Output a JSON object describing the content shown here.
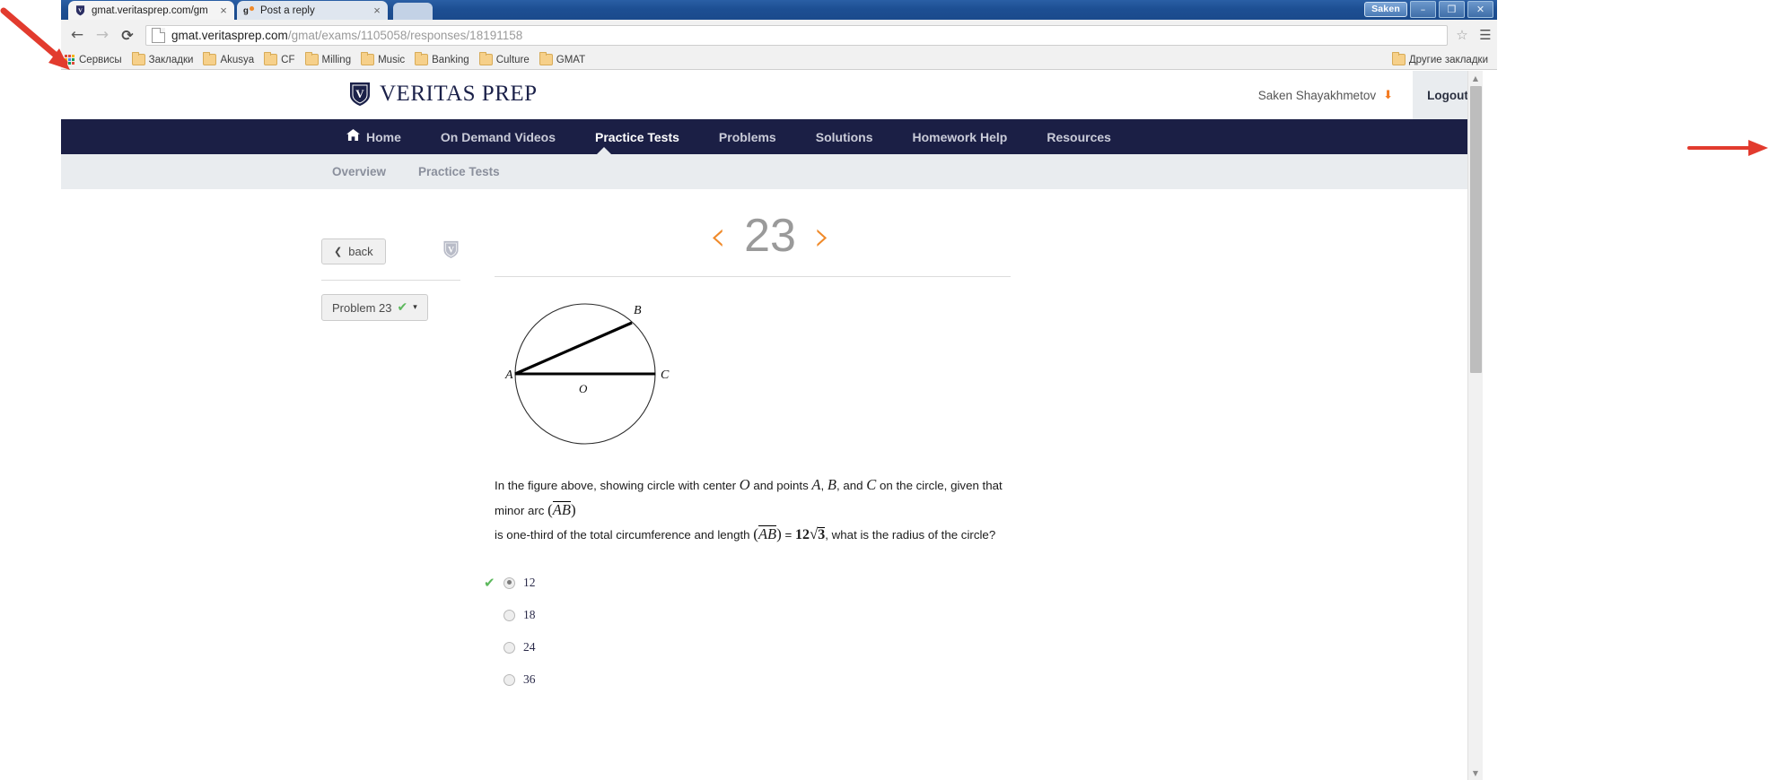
{
  "browser": {
    "tabs": [
      {
        "title": "gmat.veritasprep.com/gm",
        "favicon": "veritas-v-icon",
        "close": "×"
      },
      {
        "title": "Post a reply",
        "favicon": "gmatclub-icon",
        "close": "×"
      }
    ],
    "window_user_chip": "Saken",
    "window_buttons": {
      "minimize": "–",
      "restore": "❐",
      "close": "✕"
    },
    "nav": {
      "back": "←",
      "forward": "→",
      "reload": "⟳"
    },
    "url": {
      "domain": "gmat.veritasprep.com",
      "path": "/gmat/exams/1105058/responses/18191158"
    },
    "star_icon": "☆",
    "menu_icon": "☰",
    "bookmarks": [
      {
        "label": "Сервисы",
        "icon": "apps-grid-icon"
      },
      {
        "label": "Закладки",
        "icon": "folder-icon"
      },
      {
        "label": "Akusya",
        "icon": "folder-icon"
      },
      {
        "label": "CF",
        "icon": "folder-icon"
      },
      {
        "label": "Milling",
        "icon": "folder-icon"
      },
      {
        "label": "Music",
        "icon": "folder-icon"
      },
      {
        "label": "Banking",
        "icon": "folder-icon"
      },
      {
        "label": "Culture",
        "icon": "folder-icon"
      },
      {
        "label": "GMAT",
        "icon": "folder-icon"
      }
    ],
    "other_bookmarks": "Другие закладки"
  },
  "site": {
    "brand": "VERITAS PREP",
    "user_name": "Saken Shayakhmetov",
    "user_caret": "⬇",
    "logout_label": "Logout",
    "main_nav": [
      {
        "label": "Home",
        "icon": "home-icon",
        "active": false
      },
      {
        "label": "On Demand Videos",
        "active": false
      },
      {
        "label": "Practice Tests",
        "active": true
      },
      {
        "label": "Problems",
        "active": false
      },
      {
        "label": "Solutions",
        "active": false
      },
      {
        "label": "Homework Help",
        "active": false
      },
      {
        "label": "Resources",
        "active": false
      }
    ],
    "sub_nav": [
      {
        "label": "Overview"
      },
      {
        "label": "Practice Tests"
      }
    ],
    "colors": {
      "navy": "#1b1f45",
      "orange": "#f08a2a",
      "subnav_bg": "#e9ecef",
      "green_check": "#5cb85c"
    }
  },
  "question": {
    "number": "23",
    "prev_chevron": "‹",
    "next_chevron": "›",
    "back_label": "back",
    "back_chevron": "❮",
    "problem_label": "Problem 23",
    "problem_check": "✔",
    "problem_caret": "▾",
    "figure": {
      "type": "circle-geometry-diagram",
      "center_label": "O",
      "points": [
        "A",
        "B",
        "C"
      ],
      "segments": [
        "AC (diameter)",
        "AB (chord)"
      ]
    },
    "prompt_part1": "In the figure above, showing circle with center ",
    "prompt_O": "O",
    "prompt_part2": " and points ",
    "prompt_A": "A",
    "prompt_comma1": ", ",
    "prompt_B": "B",
    "prompt_comma2": ", and ",
    "prompt_C": "C",
    "prompt_part3": " on the circle, given that minor arc ",
    "arc_AB": "AB",
    "prompt_part4": "is one-third of the total circumference and length ",
    "len_AB": "AB",
    "equals": " = ",
    "value_12": "12",
    "radical_3": "3",
    "prompt_part5": ", what is the radius of the circle?",
    "answers": [
      {
        "label": "12",
        "selected": true,
        "correct": true
      },
      {
        "label": "18",
        "selected": false,
        "correct": false
      },
      {
        "label": "24",
        "selected": false,
        "correct": false
      },
      {
        "label": "36",
        "selected": false,
        "correct": false
      }
    ],
    "correct_mark": "✔"
  },
  "scrollbar": {
    "up_arrow": "▲",
    "down_arrow": "▼"
  }
}
